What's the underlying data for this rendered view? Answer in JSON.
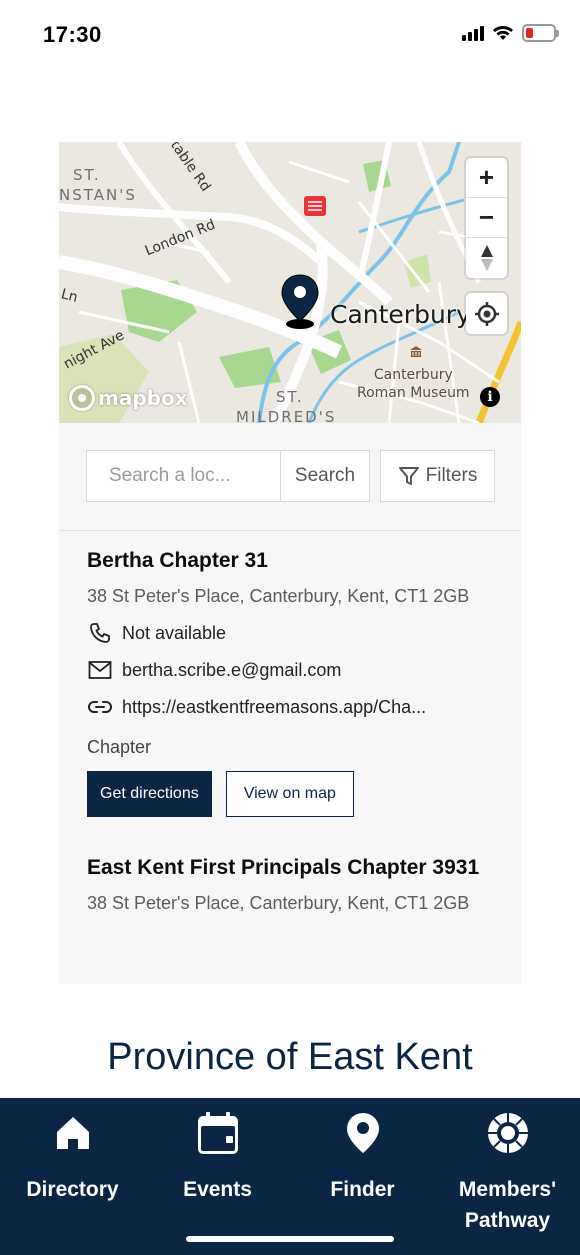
{
  "status_bar": {
    "time": "17:30",
    "battery_color": "#e0262b"
  },
  "map": {
    "labels": {
      "st_dunstans_1": "ST.",
      "st_dunstans_2": "NSTAN'S",
      "london_rd": "London Rd",
      "whitstable_rd": "table Rd",
      "ln": "Ln",
      "knight_ave": "night Ave",
      "st_mildreds_1": "ST.",
      "st_mildreds_2": "MILDRED'S",
      "place": "Canterbury",
      "museum_1": "Canterbury",
      "museum_2": "Roman Museum"
    },
    "logo_text": "mapbox",
    "info_icon": "i",
    "controls": {
      "zoom_in": "+",
      "zoom_out": "−"
    }
  },
  "search": {
    "placeholder": "Search a loc...",
    "button_label": "Search",
    "filters_label": "Filters"
  },
  "results": [
    {
      "title": "Bertha Chapter 31",
      "address": "38 St Peter's Place, Canterbury, Kent, CT1 2GB",
      "phone": "Not available",
      "email": "bertha.scribe.e@gmail.com",
      "website": "https://eastkentfreemasons.app/Cha...",
      "type": "Chapter",
      "directions_label": "Get directions",
      "view_label": "View on map"
    },
    {
      "title": "East Kent First Principals Chapter 3931",
      "address": "38 St Peter's Place, Canterbury, Kent, CT1 2GB"
    }
  ],
  "province_title": "Province of East Kent",
  "bottom_nav": [
    {
      "label": "Directory",
      "icon": "home-icon"
    },
    {
      "label": "Events",
      "icon": "calendar-icon"
    },
    {
      "label": "Finder",
      "icon": "map-pin-icon"
    },
    {
      "label": "Members' Pathway",
      "icon": "pathway-icon"
    }
  ],
  "colors": {
    "brand_navy": "#0b2545",
    "map_water": "#7cc3ea",
    "map_park": "#a7d88f",
    "map_highway": "#f4c430"
  }
}
